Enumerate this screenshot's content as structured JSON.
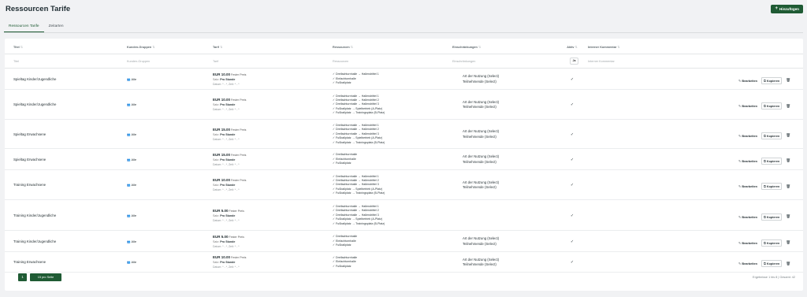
{
  "page": {
    "title": "Ressourcen Tarife",
    "add_label": "Hinzufügen"
  },
  "tabs": [
    {
      "label": "Ressourcen Tarife"
    },
    {
      "label": "Zeitarten"
    }
  ],
  "columns": {
    "title": "Titel",
    "groups": "Kunden-Gruppen",
    "tarif": "Tarif",
    "resources": "Ressourcen",
    "restrictions": "Einschränkungen",
    "active": "Aktiv",
    "comment": "Interner Kommentar"
  },
  "filters": {
    "title": "Titel",
    "groups": "Kunden-Gruppen",
    "tarif": "Tarif",
    "resources": "Ressourcen",
    "restrictions": "Einschränkungen",
    "active": "Ja",
    "comment": "Interner Kommentar"
  },
  "actions": {
    "edit": "Bearbeiten",
    "copy": "Kopieren"
  },
  "rows": [
    {
      "title": "Spieltag Kinder/Jugendliche",
      "group": "Alle",
      "price": "EUR 10.00",
      "price_type": "Fester Preis",
      "unit_label": "Satz:",
      "unit": "Pro Stunde",
      "dates": "Datum: * - *, Zeit: * - *",
      "resources": [
        "Dreifachturnhalle → Hallendrittel 1",
        "Einfachturnhalle",
        "Fußballplatz"
      ],
      "restrictions": [
        "Art der Nutzung (Select)",
        "Teilnehmende (Select)"
      ],
      "active": "✓"
    },
    {
      "title": "Spieltag Kinder/Jugendliche",
      "group": "Alle",
      "price": "EUR 10.00",
      "price_type": "Fester Preis",
      "unit_label": "Satz:",
      "unit": "Pro Stunde",
      "dates": "Datum: * - *, Zeit: * - *",
      "resources": [
        "Dreifachturnhalle → Hallendrittel 1",
        "Dreifachturnhalle → Hallendrittel 2",
        "Dreifachturnhalle → Hallendrittel 3",
        "Fußballplatz → Spielbetrieb (A-Platz)",
        "Fußballplatz → Trainingsplatz (B-Platz)"
      ],
      "restrictions": [
        "Art der Nutzung (Select)",
        "Teilnehmende (Select)"
      ],
      "active": "✓"
    },
    {
      "title": "Spieltag Erwachsene",
      "group": "Alle",
      "price": "EUR 15.00",
      "price_type": "Fester Preis",
      "unit_label": "Satz:",
      "unit": "Pro Stunde",
      "dates": "Datum: * - *, Zeit: * - *",
      "resources": [
        "Dreifachturnhalle → Hallendrittel 1",
        "Dreifachturnhalle → Hallendrittel 2",
        "Dreifachturnhalle → Hallendrittel 3",
        "Fußballplatz → Spielbetrieb (A-Platz)",
        "Fußballplatz → Trainingsplatz (B-Platz)"
      ],
      "restrictions": [
        "Art der Nutzung (Select)",
        "Teilnehmende (Select)"
      ],
      "active": "✓"
    },
    {
      "title": "Spieltag Erwachsene",
      "group": "Alle",
      "price": "EUR 15.00",
      "price_type": "Fester Preis",
      "unit_label": "Satz:",
      "unit": "Pro Stunde",
      "dates": "Datum: * - *, Zeit: * - *",
      "resources": [
        "Dreifachturnhalle",
        "Einfachturnhalle",
        "Fußballplatz"
      ],
      "restrictions": [
        "Art der Nutzung (Select)",
        "Teilnehmende (Select)"
      ],
      "active": "✓"
    },
    {
      "title": "Training Erwachsene",
      "group": "Alle",
      "price": "EUR 10.00",
      "price_type": "Fester Preis",
      "unit_label": "Satz:",
      "unit": "Pro Stunde",
      "dates": "Datum: * - *, Zeit: * - *",
      "resources": [
        "Dreifachturnhalle → Hallendrittel 1",
        "Dreifachturnhalle → Hallendrittel 2",
        "Dreifachturnhalle → Hallendrittel 3",
        "Fußballplatz → Spielbetrieb (A-Platz)",
        "Fußballplatz → Trainingsplatz (B-Platz)"
      ],
      "restrictions": [
        "Art der Nutzung (Select)",
        "Teilnehmende (Select)"
      ],
      "active": "✓"
    },
    {
      "title": "Training Kinder/Jugendliche",
      "group": "Alle",
      "price": "EUR 5.00",
      "price_type": "Fester Preis",
      "unit_label": "Satz:",
      "unit": "Pro Stunde",
      "dates": "Datum: * - *, Zeit: * - *",
      "resources": [
        "Dreifachturnhalle → Hallendrittel 1",
        "Dreifachturnhalle → Hallendrittel 2",
        "Dreifachturnhalle → Hallendrittel 3",
        "Fußballplatz → Spielbetrieb (A-Platz)",
        "Fußballplatz → Trainingsplatz (B-Platz)"
      ],
      "restrictions": [],
      "active": "✓"
    },
    {
      "title": "Training Kinder/Jugendliche",
      "group": "Alle",
      "price": "EUR 5.00",
      "price_type": "Fester Preis",
      "unit_label": "Satz:",
      "unit": "Pro Stunde",
      "dates": "Datum: * - *, Zeit: * - *",
      "resources": [
        "Dreifachturnhalle",
        "Einfachturnhalle",
        "Fußballplatz"
      ],
      "restrictions": [
        "Art der Nutzung (Select)",
        "Teilnehmende (Select)"
      ],
      "active": "✓"
    },
    {
      "title": "Training Erwachsene",
      "group": "Alle",
      "price": "EUR 10.00",
      "price_type": "Fester Preis",
      "unit_label": "Satz:",
      "unit": "Pro Stunde",
      "dates": "Datum: * - *, Zeit: * - *",
      "resources": [
        "Dreifachturnhalle",
        "Einfachturnhalle",
        "Fußballplatz"
      ],
      "restrictions": [
        "Art der Nutzung (Select)",
        "Teilnehmende (Select)"
      ],
      "active": "✓"
    }
  ],
  "pagination": {
    "page": "1",
    "per_page": "15 pro Seite",
    "info": "Ergebnisse 1 bis 8 | Gesamt: 42"
  }
}
